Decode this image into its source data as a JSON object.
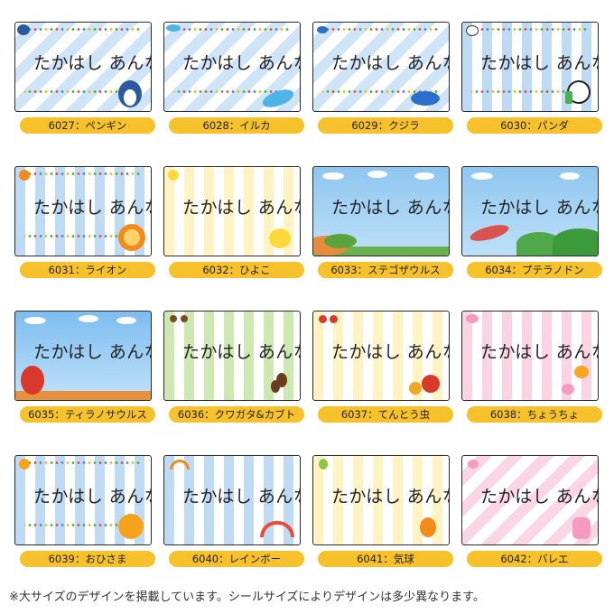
{
  "sample_name": "たかはし あんな",
  "items": [
    {
      "label": "6027：ペンギン",
      "icon": "penguin-icon",
      "bg": "bg-blue-diag"
    },
    {
      "label": "6028：イルカ",
      "icon": "dolphin-icon",
      "bg": "bg-blue-diag"
    },
    {
      "label": "6029：クジラ",
      "icon": "whale-icon",
      "bg": "bg-blue-diag"
    },
    {
      "label": "6030：パンダ",
      "icon": "panda-icon",
      "bg": "bg-blue-vert"
    },
    {
      "label": "6031：ライオン",
      "icon": "lion-icon",
      "bg": "bg-blue-vert"
    },
    {
      "label": "6032：ひよこ",
      "icon": "chick-icon",
      "bg": "bg-yellow-vert"
    },
    {
      "label": "6033：ステゴザウルス",
      "icon": "stegosaurus-icon",
      "bg": "bg-sky"
    },
    {
      "label": "6034：プテラノドン",
      "icon": "pteranodon-icon",
      "bg": "bg-sky"
    },
    {
      "label": "6035：ティラノサウルス",
      "icon": "tyrannosaurus-icon",
      "bg": "bg-sky2"
    },
    {
      "label": "6036：クワガタ&カブト",
      "icon": "beetle-icon",
      "bg": "bg-green-vert"
    },
    {
      "label": "6037：てんとう虫",
      "icon": "ladybug-icon",
      "bg": "bg-yellow-vert"
    },
    {
      "label": "6038：ちょうちょ",
      "icon": "butterfly-icon",
      "bg": "bg-pink-vert"
    },
    {
      "label": "6039：おひさま",
      "icon": "sun-icon",
      "bg": "bg-blue-vert"
    },
    {
      "label": "6040：レインボー",
      "icon": "rainbow-icon",
      "bg": "bg-blue-vert"
    },
    {
      "label": "6041：気球",
      "icon": "balloon-icon",
      "bg": "bg-yellow-vert"
    },
    {
      "label": "6042：バレエ",
      "icon": "ballet-shoes-icon",
      "bg": "bg-pink-diag"
    }
  ],
  "footnote": "※大サイズのデザインを掲載しています。シールサイズによりデザインは多少異なります。"
}
